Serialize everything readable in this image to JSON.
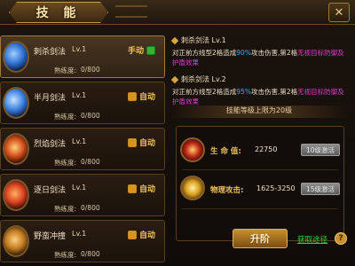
{
  "window": {
    "title": "技 能",
    "close_icon": "close-icon"
  },
  "skills": [
    {
      "name": "刺杀剑法",
      "level": "Lv.1",
      "exp_label": "熟练度:",
      "exp": "0/800",
      "auto_label": "手动",
      "auto_on": true,
      "icon": "sword-slash-icon",
      "selected": true,
      "icon_color": "#2e6fd0"
    },
    {
      "name": "半月剑法",
      "level": "Lv.1",
      "exp_label": "熟练度:",
      "exp": "0/800",
      "auto_label": "自动",
      "auto_on": false,
      "icon": "half-moon-icon",
      "selected": false,
      "icon_color": "#3a80e0"
    },
    {
      "name": "烈焰剑法",
      "level": "Lv.1",
      "exp_label": "熟练度:",
      "exp": "0/800",
      "auto_label": "自动",
      "auto_on": false,
      "icon": "flame-sword-icon",
      "selected": false,
      "icon_color": "#d04a1a"
    },
    {
      "name": "逐日剑法",
      "level": "Lv.1",
      "exp_label": "熟练度:",
      "exp": "0/800",
      "auto_label": "自动",
      "auto_on": false,
      "icon": "sun-sword-icon",
      "selected": false,
      "icon_color": "#d84020"
    },
    {
      "name": "野蛮冲撞",
      "level": "Lv.1",
      "exp_label": "熟练度:",
      "exp": "0/800",
      "auto_label": "自动",
      "auto_on": false,
      "icon": "charge-icon",
      "selected": false,
      "icon_color": "#c07a20"
    }
  ],
  "detail": {
    "current": {
      "title": "刺杀剑法 Lv.1",
      "desc_a": "对正前方线型2格造成",
      "desc_pct": "90%",
      "desc_b": "攻击伤害,第2格",
      "desc_hl": "无视目标防御及护盾效果"
    },
    "next": {
      "title": "刺杀剑法 Lv.2",
      "desc_a": "对正前方线型2格造成",
      "desc_pct": "95%",
      "desc_b": "攻击伤害,第2格",
      "desc_hl": "无视目标防御及护盾效果"
    },
    "cap_text": "技能等级上限为20级",
    "stats": [
      {
        "label": "生 命 值:",
        "value": "22750",
        "button": "10级激活",
        "icon": "blood-orb-icon"
      },
      {
        "label": "物理攻击:",
        "value": "1625-3250",
        "button": "15级激活",
        "icon": "attack-orb-icon"
      }
    ],
    "upgrade_label": "升阶",
    "get_route_label": "获取途径",
    "help_label": "?"
  },
  "colors": {
    "accent_gold": "#f2c15a",
    "highlight_blue": "#3aa8ff",
    "highlight_pink": "#e23ad0",
    "link_green": "#32d23a"
  }
}
